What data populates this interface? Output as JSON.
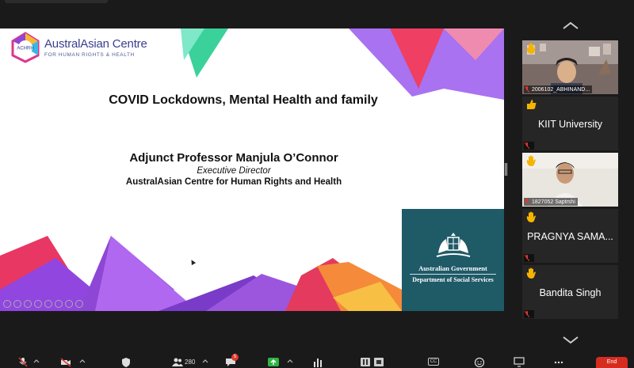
{
  "slide": {
    "logo": {
      "mark": "ACHRH",
      "title": "AustralAsian Centre",
      "subtitle": "FOR HUMAN RIGHTS & HEALTH"
    },
    "title": "COVID Lockdowns, Mental Health and family",
    "presenter_name": "Adjunct Professor  Manjula O’Connor",
    "presenter_role": "Executive Director",
    "presenter_org": "AustralAsian Centre for Human Rights and Health",
    "government": {
      "line1": "Australian Government",
      "line2": "Department of Social Services"
    }
  },
  "gallery": {
    "tiles": [
      {
        "name": "2006102_ABHINAND...",
        "reaction": "raised-hand-icon",
        "has_video": true
      },
      {
        "name": "KIIT University",
        "reaction": "thumbs-up-icon",
        "has_video": false
      },
      {
        "name": "1827052 Saptrshi",
        "reaction": "raised-hand-icon",
        "has_video": true
      },
      {
        "name": "PRAGNYA SAMA...",
        "reaction": "raised-hand-icon",
        "has_video": false
      },
      {
        "name": "Bandita Singh",
        "reaction": "raised-hand-icon",
        "has_video": false
      }
    ]
  },
  "toolbar": {
    "participants_count": "280",
    "chat_badge": "5",
    "cc_label": "CC",
    "end_label": "End"
  },
  "colors": {
    "app_bg": "#1a1a1a",
    "tile_bg": "#262626",
    "gov_box": "#1f5a67",
    "end_button": "#d62c1f",
    "share_green": "#2fb344",
    "raised_hand": "#f4b400",
    "muted_red": "#e0382f"
  }
}
